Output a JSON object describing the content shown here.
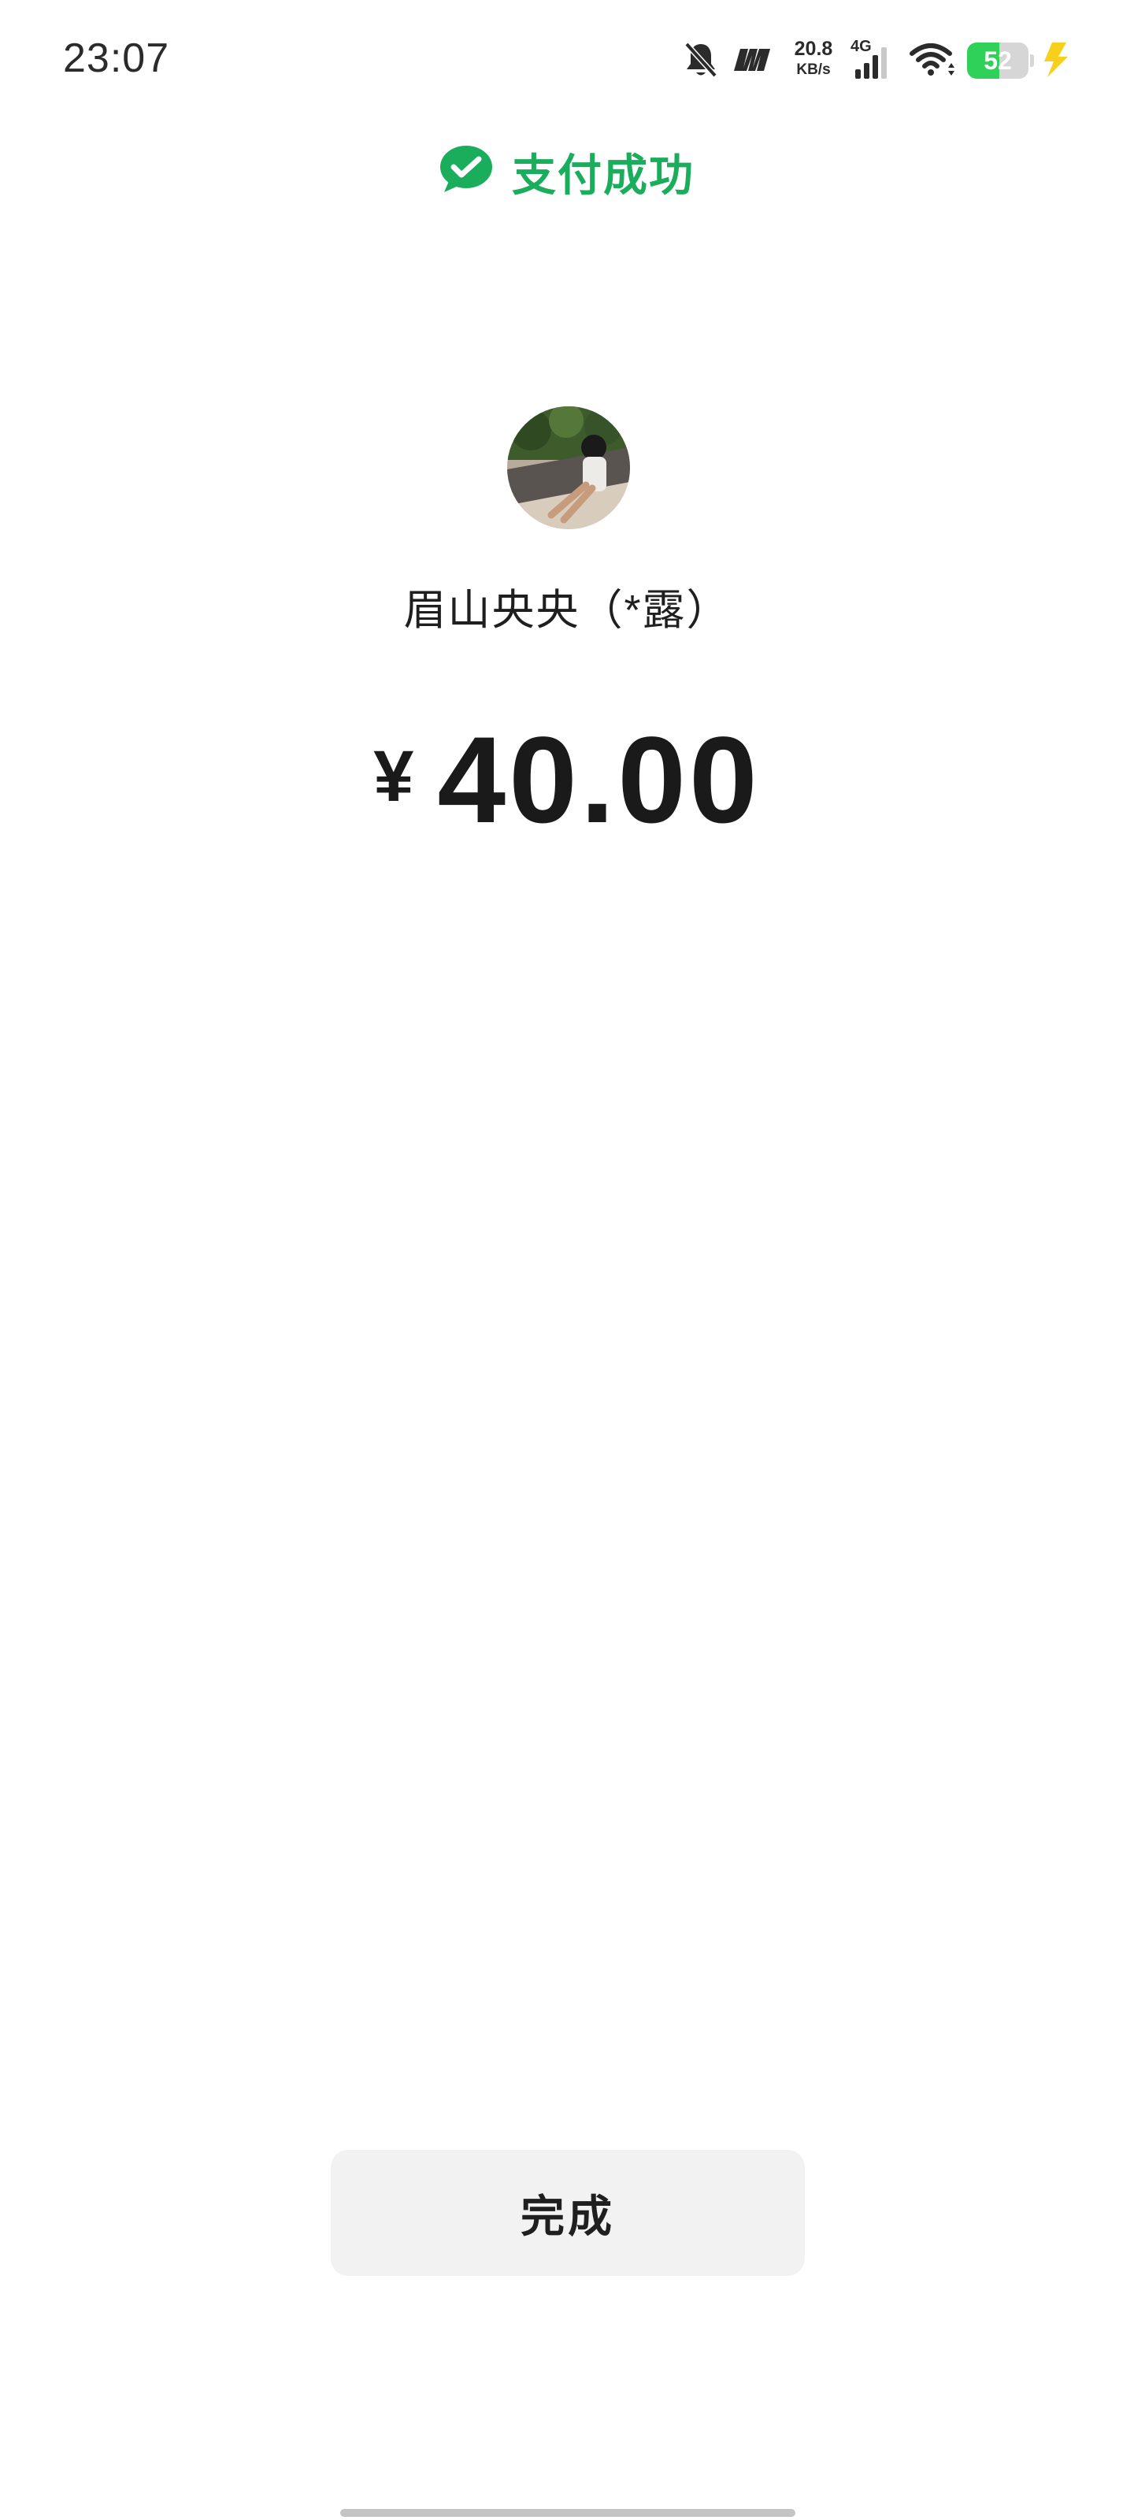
{
  "status_bar": {
    "time": "23:07",
    "net_speed_value": "20.8",
    "net_speed_unit": "KB/s",
    "network_type": "4G",
    "battery_level": "52",
    "icons": [
      "bell-mute-icon",
      "brand-m-icon",
      "signal-icon",
      "wifi-icon",
      "battery-icon",
      "charging-icon"
    ]
  },
  "header": {
    "title": "支付成功",
    "icon": "wechat-pay-icon",
    "accent_color": "#1aad5b"
  },
  "payee": {
    "name": "眉山央央（*露）",
    "avatar": "avatar-photo"
  },
  "amount": {
    "currency": "¥",
    "value": "40.00"
  },
  "actions": {
    "done_label": "完成"
  }
}
